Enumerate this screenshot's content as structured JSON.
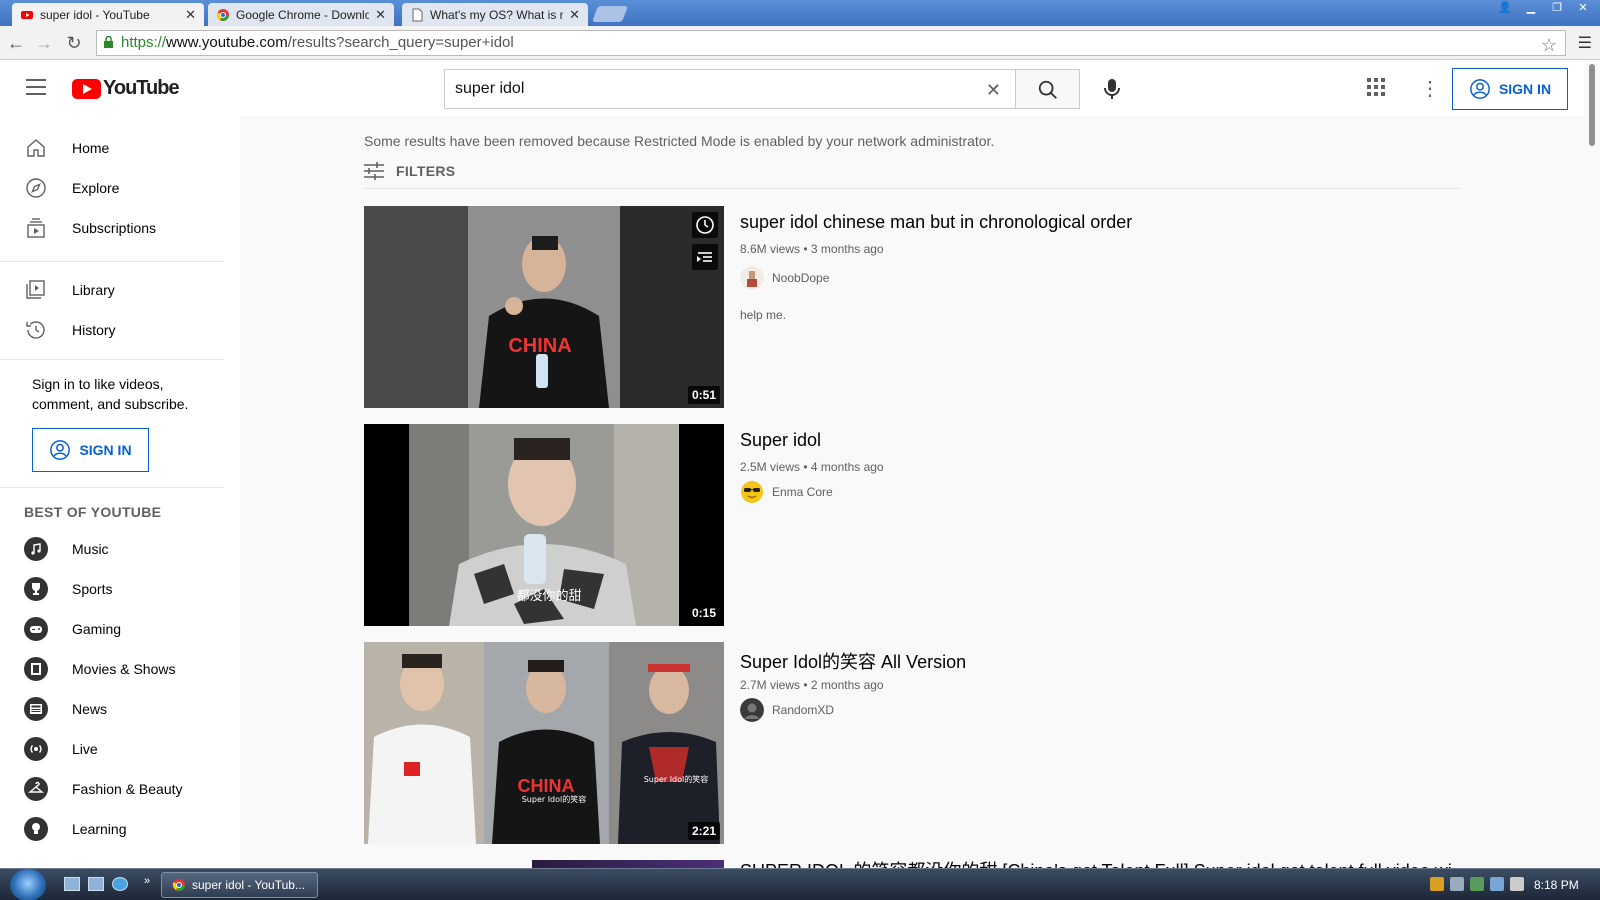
{
  "browser": {
    "tabs": [
      {
        "title": "super idol - YouTube",
        "active": true
      },
      {
        "title": "Google Chrome - Downlo",
        "active": false
      },
      {
        "title": "What's my OS? What is m",
        "active": false
      }
    ],
    "url_scheme": "https://",
    "url_host": "www.youtube.com",
    "url_path": "/results?search_query=super+idol"
  },
  "header": {
    "logo_text": "YouTube",
    "search_value": "super idol",
    "sign_in_label": "SIGN IN"
  },
  "sidebar": {
    "main_items": [
      {
        "label": "Home",
        "icon": "home-icon"
      },
      {
        "label": "Explore",
        "icon": "compass-icon"
      },
      {
        "label": "Subscriptions",
        "icon": "subscriptions-icon"
      }
    ],
    "library_items": [
      {
        "label": "Library",
        "icon": "library-icon"
      },
      {
        "label": "History",
        "icon": "history-icon"
      }
    ],
    "signin_prompt": "Sign in to like videos, comment, and subscribe.",
    "sign_in_label": "SIGN IN",
    "best_title": "BEST OF YOUTUBE",
    "categories": [
      {
        "label": "Music",
        "icon": "music-icon"
      },
      {
        "label": "Sports",
        "icon": "trophy-icon"
      },
      {
        "label": "Gaming",
        "icon": "gamepad-icon"
      },
      {
        "label": "Movies & Shows",
        "icon": "film-icon"
      },
      {
        "label": "News",
        "icon": "news-icon"
      },
      {
        "label": "Live",
        "icon": "live-icon"
      },
      {
        "label": "Fashion & Beauty",
        "icon": "hanger-icon"
      },
      {
        "label": "Learning",
        "icon": "lightbulb-icon"
      }
    ]
  },
  "results": {
    "notice": "Some results have been removed because Restricted Mode is enabled by your network administrator.",
    "filters_label": "FILTERS",
    "items": [
      {
        "title": "super idol chinese man but in chronological order",
        "meta": "8.6M views • 3 months ago",
        "channel": "NoobDope",
        "description": "help me.",
        "duration": "0:51"
      },
      {
        "title": "Super idol",
        "meta": "2.5M views • 4 months ago",
        "channel": "Enma Core",
        "description": "",
        "duration": "0:15"
      },
      {
        "title": "Super Idol的笑容 All Version",
        "meta": "2.7M views • 2 months ago",
        "channel": "RandomXD",
        "description": "",
        "duration": "2:21"
      },
      {
        "title": "SUPER IDOL 的笑容都没你的甜 [China's got Talent Full] Super idol got talent full video with",
        "meta": "",
        "channel": "",
        "description": "",
        "duration": ""
      }
    ]
  },
  "thumb_text": {
    "shirt": "CHINA",
    "caption": "都没你的甜",
    "shirt2": "CHINA",
    "small_label": "Super Idol的笑容",
    "small_label2": "Super Idol的笑容"
  },
  "taskbar": {
    "task_label": "super idol - YouTub...",
    "clock": "8:18 PM"
  },
  "colors": {
    "yt_red": "#ff0000",
    "link_blue": "#065fd4",
    "chrome_blue": "#4a7fd0"
  }
}
